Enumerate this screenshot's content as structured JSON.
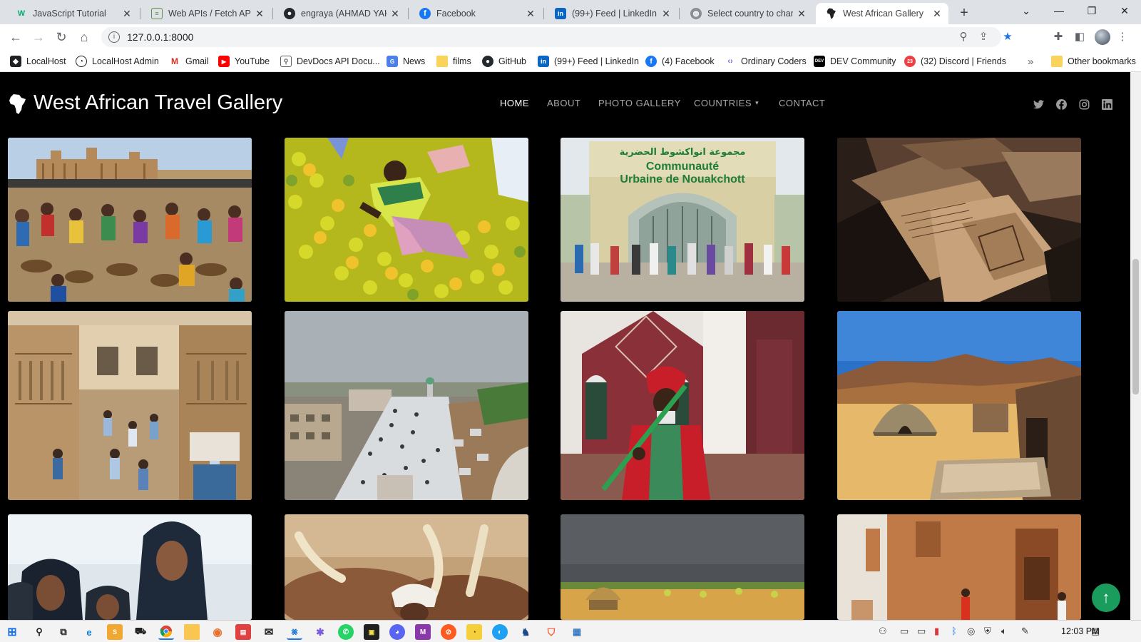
{
  "browser": {
    "tabs": [
      {
        "label": "JavaScript Tutorial",
        "icon": "w3schools-icon",
        "active": false
      },
      {
        "label": "Web APIs / Fetch API: U",
        "icon": "doc-icon",
        "active": false
      },
      {
        "label": "engraya (AHMAD YAKU",
        "icon": "github-icon",
        "active": false
      },
      {
        "label": "Facebook",
        "icon": "facebook-icon",
        "active": false
      },
      {
        "label": "(99+) Feed | LinkedIn",
        "icon": "linkedin-icon",
        "active": false
      },
      {
        "label": "Select country to chang",
        "icon": "globe-icon",
        "active": false
      },
      {
        "label": "West African Gallery",
        "icon": "africa-icon",
        "active": true
      }
    ],
    "url": "127.0.0.1:8000",
    "bookmarks": [
      {
        "label": "LocalHost",
        "icon": "localhost-icon"
      },
      {
        "label": "LocalHost Admin",
        "icon": "admin-icon"
      },
      {
        "label": "Gmail",
        "icon": "gmail-icon"
      },
      {
        "label": "YouTube",
        "icon": "youtube-icon"
      },
      {
        "label": "DevDocs API Docu...",
        "icon": "devdocs-icon"
      },
      {
        "label": "News",
        "icon": "news-icon"
      },
      {
        "label": "films",
        "icon": "folder-icon"
      },
      {
        "label": "GitHub",
        "icon": "github-icon"
      },
      {
        "label": "(99+) Feed | LinkedIn",
        "icon": "linkedin-icon"
      },
      {
        "label": "(4) Facebook",
        "icon": "facebook-icon"
      },
      {
        "label": "Ordinary Coders",
        "icon": "code-icon"
      },
      {
        "label": "DEV Community",
        "icon": "dev-icon"
      },
      {
        "label": "(32) Discord | Friends",
        "icon": "discord-icon"
      }
    ],
    "other_bookmarks": "Other bookmarks",
    "bookmark_overflow": "»"
  },
  "site": {
    "title": "West African Travel Gallery",
    "nav": [
      {
        "label": "HOME",
        "active": true
      },
      {
        "label": "ABOUT",
        "active": false
      },
      {
        "label": "PHOTO GALLERY",
        "active": false
      },
      {
        "label": "COUNTRIES",
        "active": false
      },
      {
        "label": "CONTACT",
        "active": false
      }
    ],
    "social": [
      "twitter-icon",
      "facebook-icon",
      "instagram-icon",
      "linkedin-icon"
    ],
    "gallery": [
      {
        "name": "djenne-market"
      },
      {
        "name": "orange-market"
      },
      {
        "name": "nouakchott-gate",
        "sign_arabic": "مجموعة انواكشوط الحضرية",
        "sign_line1": "Communauté",
        "sign_line2": "Urbaine de Nouakchott"
      },
      {
        "name": "ancient-manuscripts"
      },
      {
        "name": "courtyard-market"
      },
      {
        "name": "street-crowd"
      },
      {
        "name": "guard-red-turban"
      },
      {
        "name": "desert-huts"
      },
      {
        "name": "veiled-people"
      },
      {
        "name": "cattle-herder"
      },
      {
        "name": "savanna-hut"
      },
      {
        "name": "mud-village"
      }
    ],
    "scroll_top_icon": "↑"
  },
  "taskbar": {
    "time": "12:03 PM",
    "badge_count": "23"
  },
  "colors": {
    "accent_green": "#1a9c5d",
    "tab_bar": "#dee1e6",
    "page_bg": "#000000"
  }
}
